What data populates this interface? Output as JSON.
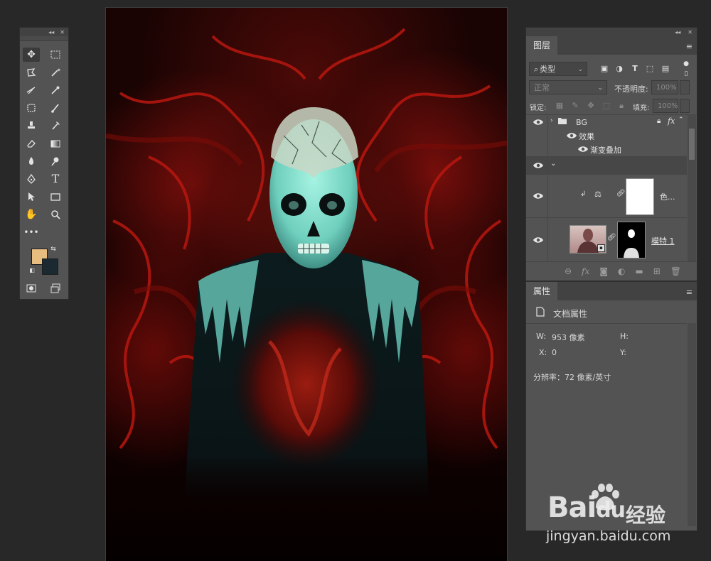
{
  "layers_panel": {
    "tab": "图层",
    "filter_kind": "类型",
    "blend_mode": "正常",
    "opacity_label": "不透明度:",
    "opacity_value": "100%",
    "lock_label": "锁定:",
    "fill_label": "填充:",
    "fill_value": "100%",
    "layers": [
      {
        "name": "BG",
        "type": "group",
        "badge": "fx"
      },
      {
        "name": "效果",
        "type": "effects"
      },
      {
        "name": "渐变叠加",
        "type": "effect"
      },
      {
        "name": "",
        "type": "group-expanded"
      },
      {
        "name": "色...",
        "type": "adjustment"
      },
      {
        "name": "模特 1",
        "type": "smart-object"
      }
    ]
  },
  "properties_panel": {
    "tab": "属性",
    "section": "文档属性",
    "w_label": "W:",
    "w_value": "953 像素",
    "h_label": "H:",
    "x_label": "X:",
    "x_value": "0",
    "y_label": "Y:",
    "resolution": "分辨率：72 像素/英寸"
  },
  "toolbar": {
    "foreground_color": "#E8BE80",
    "background_color": "#1A2A30"
  },
  "watermark": {
    "brand": "Bai",
    "brand2": "du",
    "cn": "经验",
    "url": "jingyan.baidu.com"
  }
}
